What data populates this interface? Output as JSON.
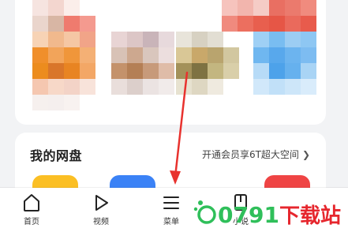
{
  "disk": {
    "title": "我的网盘",
    "vip_link": "开通会员享6T超大空间"
  },
  "tabs": [
    {
      "label": "首页",
      "icon": "home-icon"
    },
    {
      "label": "视频",
      "icon": "play-icon"
    },
    {
      "label": "菜单",
      "icon": "menu-icon"
    },
    {
      "label": "小说",
      "icon": "book-icon"
    }
  ],
  "watermark": {
    "text": "0791下载站"
  },
  "colors": {
    "arrow": "#e8322e",
    "shortcut_yellow": "#fbbf24",
    "shortcut_blue": "#3b82f6",
    "shortcut_red": "#ef4444",
    "watermark_green": "#2fbf5a",
    "watermark_red": "#e6262d"
  }
}
